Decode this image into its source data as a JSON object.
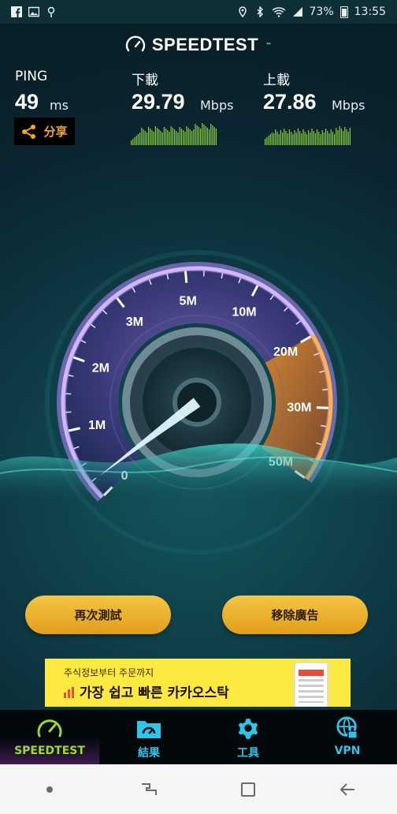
{
  "status_bar": {
    "left_icons": [
      "facebook-icon",
      "gallery-icon",
      "location-pin-icon"
    ],
    "right_icons": [
      "location-icon",
      "bluetooth-icon",
      "wifi-icon",
      "signal-icon"
    ],
    "battery": "73%",
    "time": "13:55"
  },
  "header": {
    "logo_text": "SPEEDTEST",
    "trademark": "™"
  },
  "ping": {
    "label": "PING",
    "value": "49",
    "unit": "ms"
  },
  "download": {
    "label": "下載",
    "value": "29.79",
    "unit": "Mbps"
  },
  "upload": {
    "label": "上載",
    "value": "27.86",
    "unit": "Mbps"
  },
  "share": {
    "label": "分享"
  },
  "gauge": {
    "ticks": [
      "0",
      "1M",
      "2M",
      "3M",
      "5M",
      "10M",
      "20M",
      "30M",
      "50M"
    ],
    "needle_value": "0"
  },
  "actions": {
    "retest_label": "再次測試",
    "remove_ads_label": "移除廣告"
  },
  "ad": {
    "line1": "주식정보부터 주문까지",
    "line2_prefix": "가장 쉽고 빠른 ",
    "line2_highlight": "카카오스탁"
  },
  "bottom_nav": {
    "items": [
      {
        "label": "SPEEDTEST",
        "icon": "speedometer-icon",
        "active": true
      },
      {
        "label": "結果",
        "icon": "results-folder-icon",
        "active": false
      },
      {
        "label": "工具",
        "icon": "gear-icon",
        "active": false
      },
      {
        "label": "VPN",
        "icon": "vpn-globe-lock-icon",
        "active": false
      }
    ]
  },
  "colors": {
    "accent_green": "#9bdb2f",
    "accent_cyan": "#2dc6ea",
    "button_gold": "#f0b52e",
    "share_orange": "#f6a623"
  }
}
